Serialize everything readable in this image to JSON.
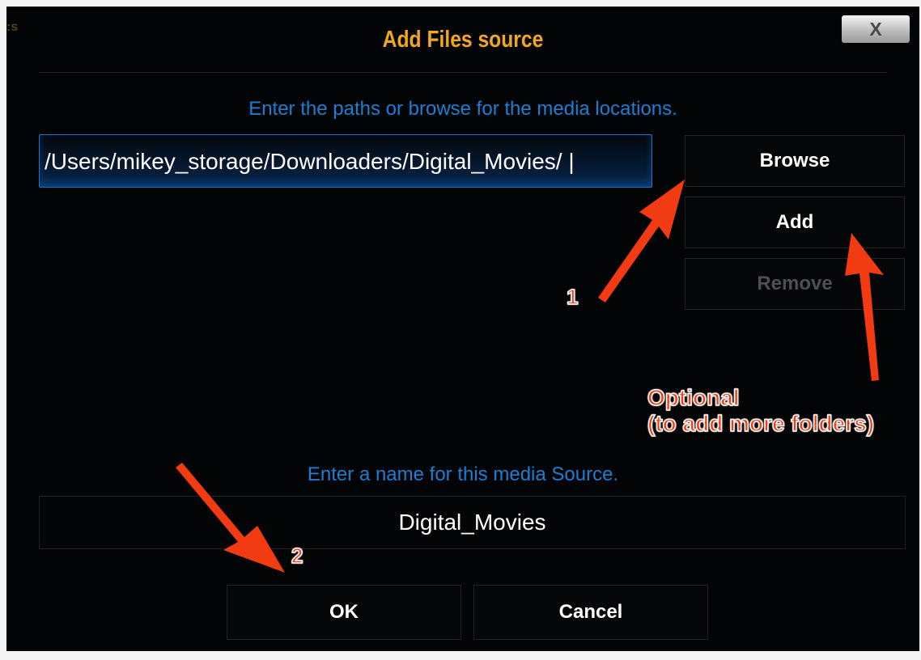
{
  "dialog": {
    "title": "Add Files source",
    "close_label": "X",
    "paths_hint": "Enter the paths or browse for the media locations.",
    "path_value": "/Users/mikey_storage/Downloaders/Digital_Movies/ |",
    "buttons": {
      "browse": "Browse",
      "add": "Add",
      "remove": "Remove"
    },
    "name_hint": "Enter a name for this media Source.",
    "name_value": "Digital_Movies",
    "ok": "OK",
    "cancel": "Cancel"
  },
  "annotations": {
    "step1": "1",
    "step2": "2",
    "optional_line1": "Optional",
    "optional_line2": "(to add more folders)"
  },
  "colors": {
    "title": "#f2a81d",
    "hint": "#1b7fd4",
    "annotation": "#f23b12",
    "background": "#030405"
  },
  "icons": {
    "close": "close-icon",
    "arrows": "red-arrow-icon"
  }
}
